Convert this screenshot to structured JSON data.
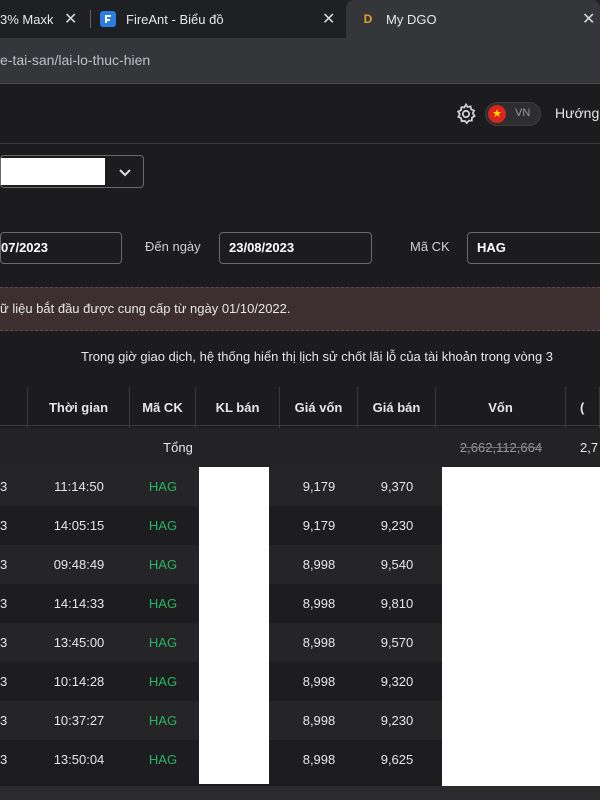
{
  "browser": {
    "tabs": [
      {
        "label": "3% Maxk",
        "close": "✕"
      },
      {
        "label": "FireAnt - Biểu đồ",
        "close": "✕"
      },
      {
        "label": "My DGO",
        "close": "✕",
        "favicon": "D"
      }
    ],
    "url": "e-tai-san/lai-lo-thuc-hien"
  },
  "header": {
    "lang_label": "VN",
    "guide_label": "Hướng"
  },
  "filters": {
    "from_date": "07/2023",
    "to_label": "Đến ngày",
    "to_date": "23/08/2023",
    "stock_label": "Mã CK",
    "stock_value": "HAG"
  },
  "notice": "ữ liệu bắt đầu được cung cấp từ ngày 01/10/2022.",
  "info": "Trong giờ giao dịch, hệ thống hiển thị lịch sử chốt lãi lỗ của tài khoản trong vòng 3",
  "table": {
    "headers": [
      "",
      "Thời gian",
      "Mã CK",
      "KL bán",
      "Giá vốn",
      "Giá bán",
      "Vốn",
      "("
    ],
    "total": {
      "label": "Tổng",
      "von": "2,662,112,664",
      "next": "2,7"
    },
    "rows": [
      {
        "d": "3",
        "time": "11:14:50",
        "code": "HAG",
        "cost": "9,179",
        "price": "9,370"
      },
      {
        "d": "3",
        "time": "14:05:15",
        "code": "HAG",
        "cost": "9,179",
        "price": "9,230"
      },
      {
        "d": "3",
        "time": "09:48:49",
        "code": "HAG",
        "cost": "8,998",
        "price": "9,540"
      },
      {
        "d": "3",
        "time": "14:14:33",
        "code": "HAG",
        "cost": "8,998",
        "price": "9,810"
      },
      {
        "d": "3",
        "time": "13:45:00",
        "code": "HAG",
        "cost": "8,998",
        "price": "9,570"
      },
      {
        "d": "3",
        "time": "10:14:28",
        "code": "HAG",
        "cost": "8,998",
        "price": "9,320"
      },
      {
        "d": "3",
        "time": "10:37:27",
        "code": "HAG",
        "cost": "8,998",
        "price": "9,230"
      },
      {
        "d": "3",
        "time": "13:50:04",
        "code": "HAG",
        "cost": "8,998",
        "price": "9,625"
      }
    ]
  },
  "colors": {
    "accent_green": "#28b463",
    "notice_bg": "#3d2f2f",
    "background": "#1c1c1e"
  },
  "icons": [
    "fireant-icon",
    "dgo-icon",
    "close-icon",
    "gear-icon",
    "vietnam-flag-icon",
    "chevron-down-icon"
  ]
}
